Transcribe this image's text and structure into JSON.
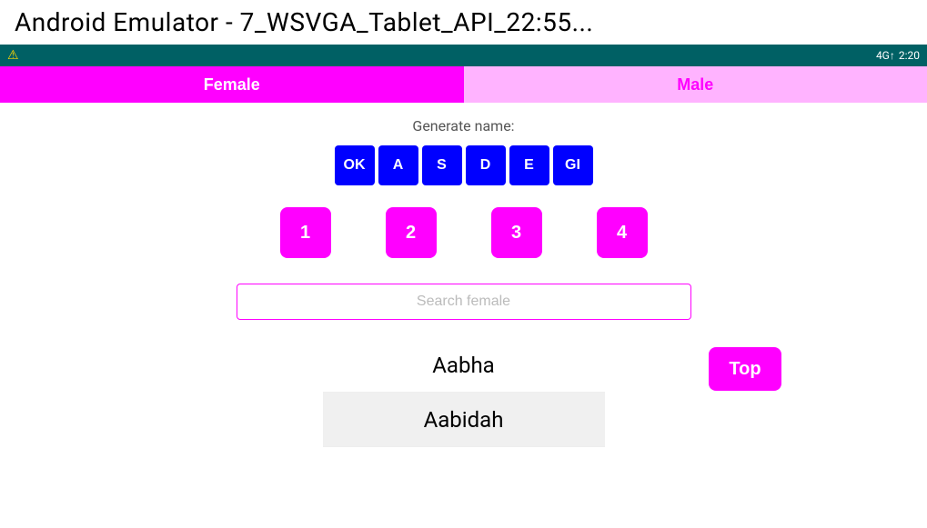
{
  "titleBar": {
    "title": "Android Emulator - 7_WSVGA_Tablet_API_22:55..."
  },
  "statusBar": {
    "warningIcon": "⚠",
    "signalText": "4G↑",
    "batteryText": "⬛",
    "timeText": "2:20"
  },
  "tabs": {
    "female": "Female",
    "male": "Male"
  },
  "generateSection": {
    "label": "Generate name:",
    "letters": [
      "OK",
      "A",
      "S",
      "D",
      "E",
      "GI"
    ],
    "numbers": [
      "1",
      "2",
      "3",
      "4"
    ]
  },
  "searchInput": {
    "placeholder": "Search female",
    "value": ""
  },
  "nameList": [
    {
      "name": "Aabha",
      "shade": "white"
    },
    {
      "name": "Aabidah",
      "shade": "gray"
    }
  ],
  "topButton": {
    "label": "Top"
  }
}
